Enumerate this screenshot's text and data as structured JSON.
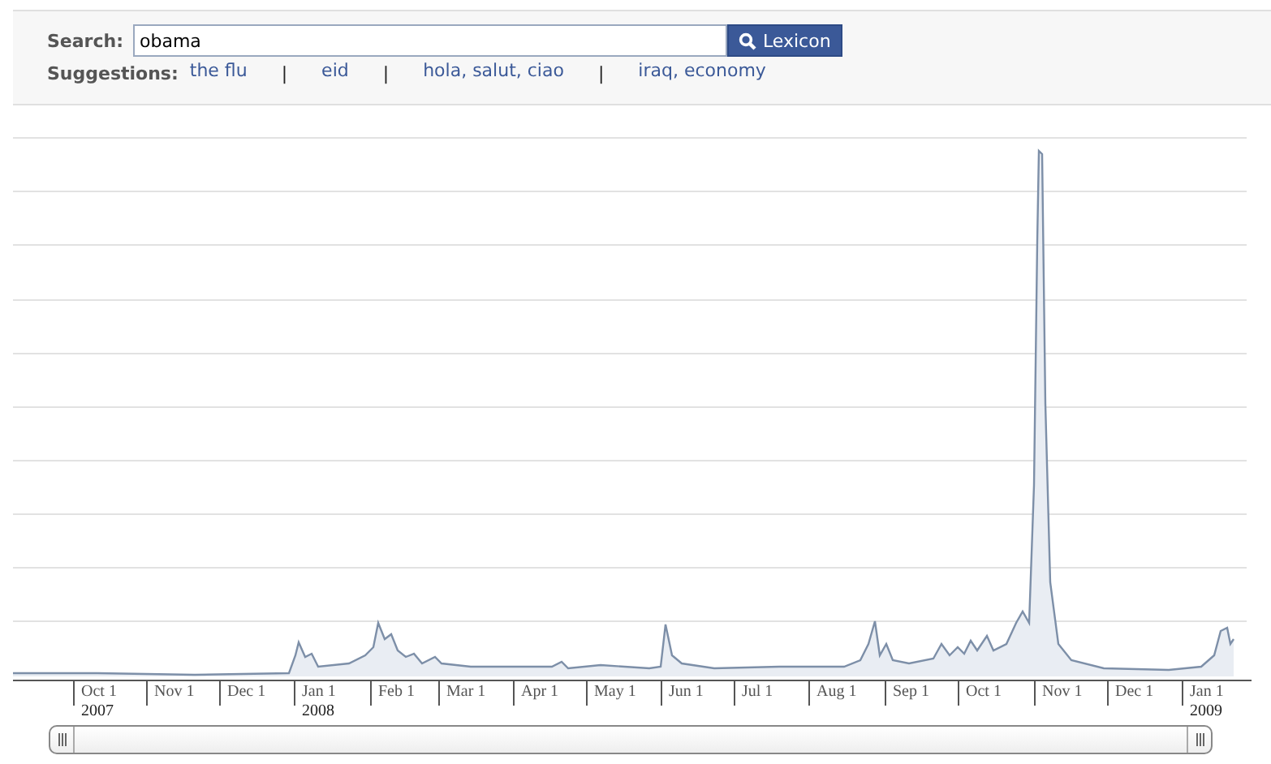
{
  "search": {
    "label": "Search:",
    "value": "obama",
    "button": "Lexicon"
  },
  "suggestions": {
    "label": "Suggestions:",
    "items": [
      {
        "kind": "link",
        "text": "the flu"
      },
      {
        "kind": "separator",
        "text": "|"
      },
      {
        "kind": "link",
        "text": "eid"
      },
      {
        "kind": "separator",
        "text": "|"
      },
      {
        "kind": "link",
        "text": "hola, salut, ciao"
      },
      {
        "kind": "separator",
        "text": "|"
      },
      {
        "kind": "link",
        "text": "iraq, economy"
      }
    ]
  },
  "chart": {
    "kind": "picture",
    "axis": [
      {
        "label": "Oct 1",
        "year": "2007"
      },
      {
        "label": "Nov 1"
      },
      {
        "label": "Dec 1"
      },
      {
        "label": "Jan 1",
        "year": "2008"
      },
      {
        "label": "Feb 1"
      },
      {
        "label": "Mar 1"
      },
      {
        "label": "Apr 1"
      },
      {
        "label": "May 1"
      },
      {
        "label": "Jun 1"
      },
      {
        "label": "Jul 1"
      },
      {
        "label": "Aug 1"
      },
      {
        "label": "Sep 1"
      },
      {
        "label": "Oct 1"
      },
      {
        "label": "Nov 1"
      },
      {
        "label": "Dec 1"
      },
      {
        "label": "Jan 1",
        "year": "2009"
      }
    ]
  }
}
